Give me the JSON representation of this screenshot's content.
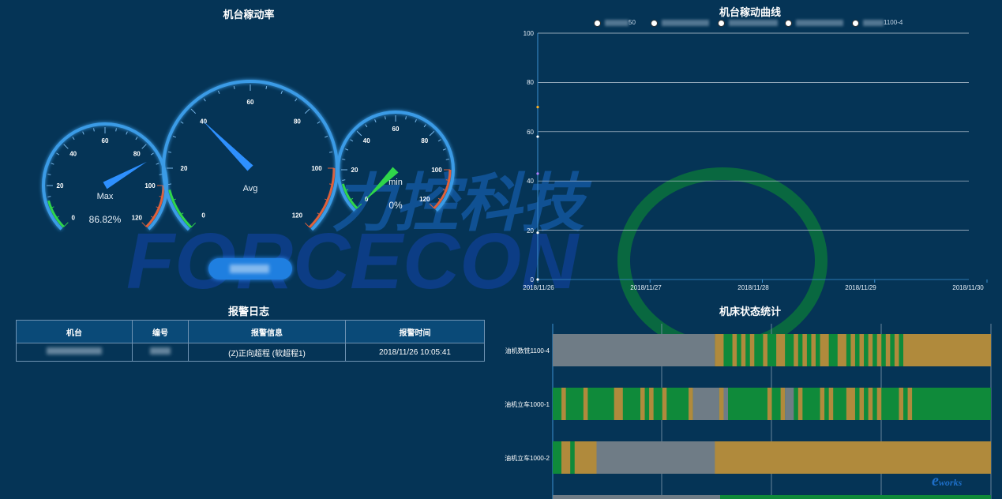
{
  "utilization": {
    "title": "机台稼动率",
    "gauges": [
      {
        "id": "max",
        "label": "Max",
        "value": 86.82,
        "value_text": "86.82%",
        "ticks": [
          "0",
          "20",
          "40",
          "60",
          "80",
          "100",
          "120"
        ]
      },
      {
        "id": "avg",
        "label": "Avg",
        "value": 40,
        "ticks": [
          "0",
          "20",
          "40",
          "60",
          "80",
          "100",
          "120"
        ]
      },
      {
        "id": "min",
        "label": "min",
        "value": 0,
        "value_text": "0%",
        "ticks": [
          "0",
          "20",
          "40",
          "60",
          "80",
          "100",
          "120"
        ]
      }
    ]
  },
  "alarm_log": {
    "title": "报警日志",
    "headers": [
      "机台",
      "编号",
      "报警信息",
      "报警时间"
    ],
    "rows": [
      {
        "info": "(Z)正向超程 (软超程1)",
        "time": "2018/11/26 10:05:41"
      }
    ]
  },
  "curve": {
    "title": "机台稼动曲线",
    "legend": [
      "50",
      "",
      "",
      "",
      "1100-4"
    ]
  },
  "chart_data": [
    {
      "type": "line",
      "title": "机台稼动曲线",
      "x": [
        "2018/11/26",
        "2018/11/27",
        "2018/11/28",
        "2018/11/29",
        "2018/11/30"
      ],
      "ylim": [
        0,
        100
      ],
      "yticks": [
        "0",
        "20",
        "40",
        "60",
        "80",
        "100"
      ],
      "grid": true,
      "legend_position": "top",
      "series": [
        {
          "values": [
            70
          ],
          "color": "#ffb020"
        },
        {
          "values": [
            58
          ],
          "color": "#ffffff"
        },
        {
          "values": [
            43
          ],
          "color": "#b080ff"
        },
        {
          "values": [
            19
          ],
          "color": "#ffffff"
        },
        {
          "values": [
            0
          ],
          "color": "#ffffff"
        }
      ]
    },
    {
      "type": "bar",
      "title": "机床状态统计",
      "categories": [
        "油机数铣1100-4",
        "油机立车1000-1",
        "油机立车1000-2"
      ],
      "colors": {
        "idle": "#6f7c86",
        "run": "#0f8a3a",
        "alarm": "#b08a3c"
      }
    }
  ],
  "status": {
    "title": "机床状态统计",
    "rows": [
      "油机数铣1100-4",
      "油机立车1000-1",
      "油机立车1000-2"
    ]
  },
  "colors": {
    "background": "#053456",
    "gauge_ring": "#3a9be6",
    "needle_blue": "#2e90ff",
    "needle_green": "#2fd64a"
  }
}
